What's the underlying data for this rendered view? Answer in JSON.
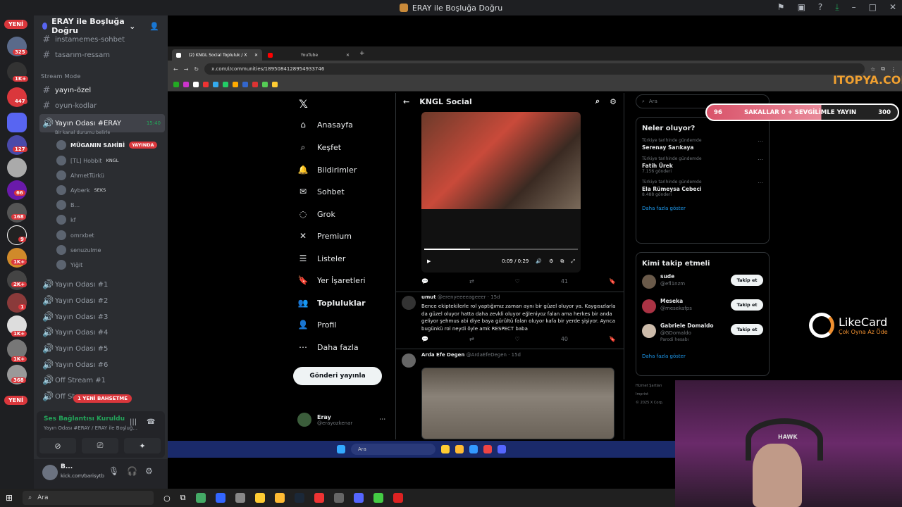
{
  "window": {
    "title": "ERAY ile Boşluğa Doğru"
  },
  "rail": {
    "yeni_top": "YENİ",
    "yeni_bottom": "YENİ",
    "badges": [
      "325",
      "1K+",
      "447",
      "127",
      "66",
      "168",
      "9",
      "1K+",
      "2K+",
      "1",
      "1K+",
      "1K+",
      "368"
    ]
  },
  "channels": {
    "server_name": "ERAY ile Boşluğa Doğru",
    "top_channels": [
      "instamemes-sohbet",
      "tasarım-ressam"
    ],
    "category": "Stream Mode",
    "text_channels": [
      "yayın-özel",
      "oyun-kodlar"
    ],
    "active_voice": {
      "name": "Yayın Odası #ERAY",
      "time": "15:40",
      "status": "Bir kanal durumu belirle"
    },
    "users": [
      {
        "name": "MÜGANIN SAHİBİ",
        "tag": "YAYINDA"
      },
      {
        "name": "[TL] Hobbit",
        "tag": "KNGL"
      },
      {
        "name": "AhmetTürkü",
        "tag": ""
      },
      {
        "name": "Ayberk",
        "tag": "SEKS"
      },
      {
        "name": "B...",
        "tag": ""
      },
      {
        "name": "kf",
        "tag": ""
      },
      {
        "name": "omrxbet",
        "tag": ""
      },
      {
        "name": "senuzulme",
        "tag": ""
      },
      {
        "name": "Yiğit",
        "tag": ""
      }
    ],
    "voice_channels": [
      "Yayın Odası #1",
      "Yayın Odası #2",
      "Yayın Odası #3",
      "Yayın Odası #4",
      "Yayın Odası #5",
      "Yayın Odası #6",
      "Off Stream #1",
      "Off St"
    ],
    "mention_pill": "1 YENİ BAHSETME"
  },
  "voice_connection": {
    "title": "Ses Bağlantısı Kuruldu",
    "subtitle": "Yayın Odası #ERAY / ERAY ile Boşluğ..."
  },
  "user_panel": {
    "name": "B...",
    "status": "kick.com/barisytb"
  },
  "browser": {
    "tabs": [
      {
        "label": "(2) KNGL Social Topluluk / X",
        "active": true
      },
      {
        "label": "YouTube",
        "active": false
      }
    ],
    "url": "x.com/i/communities/1895084128954933746"
  },
  "x_nav": {
    "items": [
      "Anasayfa",
      "Keşfet",
      "Bildirimler",
      "Sohbet",
      "Grok",
      "Premium",
      "Listeler",
      "Yer İşaretleri",
      "Topluluklar",
      "Profil",
      "Daha fazla"
    ],
    "post_button": "Gönderi yayınla",
    "me_name": "Eray",
    "me_handle": "@erayozkenar"
  },
  "feed": {
    "title": "KNGL Social",
    "video_time": "0:09 / 0:29",
    "video_likes": "41",
    "tweet1": {
      "author": "umut",
      "handle": "@erenyeeeeageeer · 15d",
      "text": "Bence ekiptekilerle rol yaptığımız zaman aynı bir güzel oluyor ya. Kaygısızlarla da güzel oluyor hatta daha zevkli oluyor eğleniyoz falan ama herkes bir anda geliyor şehmus abi diye baya gürültü falan oluyor kafa bir yerde şişiyor. Ayrıca bugünkü rol neydi öyle amk RESPECT baba",
      "likes": "40"
    },
    "tweet2": {
      "author": "Arda Efe Degen",
      "handle": "@ArdaEfeDegen · 15d"
    }
  },
  "sidebar": {
    "search_placeholder": "Ara",
    "trends_title": "Neler oluyor?",
    "trends": [
      {
        "context": "Türkiye tarihinde gündemde",
        "title": "Serenay Sarıkaya",
        "sub": ""
      },
      {
        "context": "Türkiye tarihinde gündemde",
        "title": "Fatih Ürek",
        "sub": "7.156 gönderi"
      },
      {
        "context": "Türkiye tarihinde gündemde",
        "title": "Ela Rümeysa Cebeci",
        "sub": "8.488 gönderi"
      }
    ],
    "show_more": "Daha fazla göster",
    "follow_title": "Kimi takip etmeli",
    "follow": [
      {
        "name": "sude",
        "handle": "@efl1nzm",
        "note": ""
      },
      {
        "name": "Meseka",
        "handle": "@mesekafps",
        "note": ""
      },
      {
        "name": "Gabriele Domaldo",
        "handle": "@GDomaldo",
        "note": "Parodi hesabı"
      }
    ],
    "follow_btn": "Takip et",
    "footer": [
      "Hizmet Şartları",
      "Imprint",
      "© 2025 X Corp."
    ]
  },
  "overlays": {
    "brand": "ITOPYA.COM",
    "subgoal_left": "96",
    "subgoal_text": "SAKALLAR 0 + SEVGİLİMLE YAYIN",
    "subgoal_right": "300",
    "likecard_title": "LikeCard",
    "likecard_sub": "Çok Oyna  Az Öde",
    "cam_text": "HAWK"
  },
  "taskbar": {
    "search": "Ara",
    "inner_search": "Ara"
  }
}
